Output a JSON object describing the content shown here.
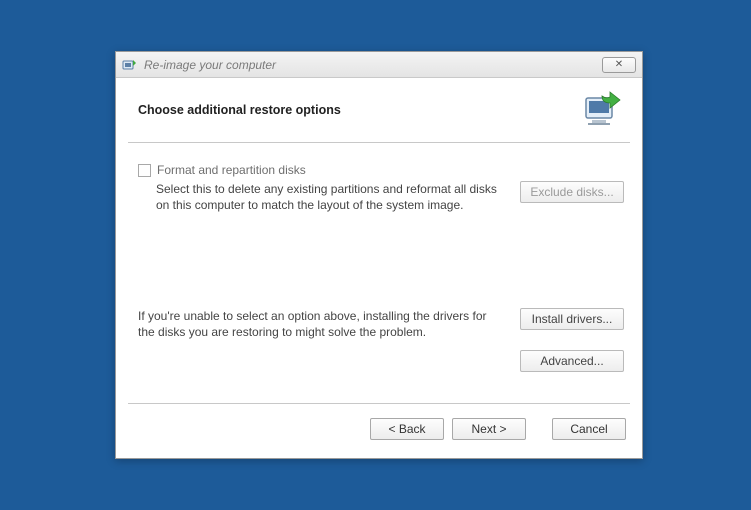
{
  "window": {
    "title": "Re-image your computer",
    "close_glyph": "✕"
  },
  "header": {
    "heading": "Choose additional restore options"
  },
  "options": {
    "format_checkbox_label": "Format and repartition disks",
    "format_description": "Select this to delete any existing partitions and reformat all disks on this computer to match the layout of the system image.",
    "exclude_button": "Exclude disks...",
    "drivers_description": "If you're unable to select an option above, installing the drivers for the disks you are restoring to might solve the problem.",
    "install_drivers_button": "Install drivers...",
    "advanced_button": "Advanced..."
  },
  "footer": {
    "back": "< Back",
    "next": "Next >",
    "cancel": "Cancel"
  }
}
